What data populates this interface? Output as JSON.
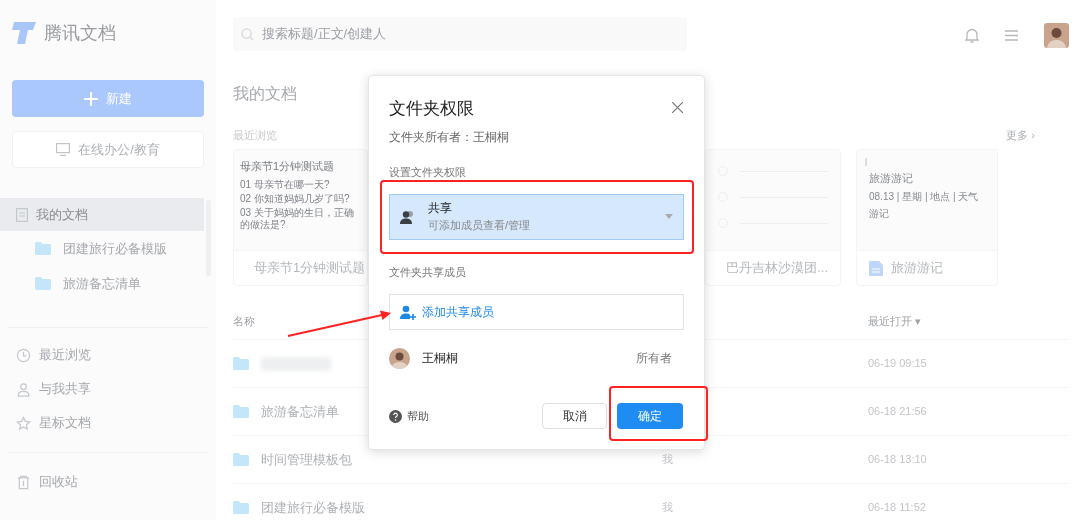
{
  "app": {
    "logo": "腾讯文档"
  },
  "sidebar": {
    "new_button": "新建",
    "office_button": "在线办公/教育",
    "tree": [
      {
        "label": "我的文档",
        "selected": true,
        "children": [
          {
            "label": "团建旅行必备模版",
            "selected": false
          },
          {
            "label": "旅游备忘清单",
            "selected": false
          }
        ]
      }
    ],
    "nav": [
      {
        "label": "最近浏览",
        "kind": "clock",
        "selected": false
      },
      {
        "label": "与我共享",
        "kind": "user",
        "selected": false
      },
      {
        "label": "星标文档",
        "kind": "star",
        "selected": false
      }
    ],
    "trash": {
      "label": "回收站",
      "kind": "trash"
    }
  },
  "header": {
    "search": {
      "placeholder": "搜索标题/正文/创建人"
    }
  },
  "main": {
    "title": "我的文档",
    "recent_label": "最近浏览",
    "more": "更多",
    "more_chevron": "›",
    "recent": [
      {
        "kind": "quiz",
        "preview_title": "母亲节1分钟测试题",
        "preview_lines": [
          "01  母亲节在哪一天?",
          "02  你知道妈妈几岁了吗?",
          "03  关于妈妈的生日，正确的做法是?"
        ],
        "name": "母亲节1分钟测试题"
      },
      {
        "kind": "checklist",
        "name": "巴丹吉林沙漠团..."
      },
      {
        "kind": "note",
        "preview_title": "旅游游记",
        "preview_lines": [
          "08.13 | 星期 | 地点 | 天气",
          "游记"
        ],
        "name": "旅游游记"
      }
    ],
    "columns": {
      "name": "名称",
      "opened": "最近打开",
      "sort_caret": "▾"
    },
    "rows": [
      {
        "name": "",
        "owner": "",
        "opened": "06-19 09:15"
      },
      {
        "name": "旅游备忘清单",
        "owner": "",
        "opened": "06-18 21:56"
      },
      {
        "name": "时间管理模板包",
        "owner": "我",
        "opened": "06-18 13:10"
      },
      {
        "name": "团建旅行必备模版",
        "owner": "我",
        "opened": "06-18 11:52"
      }
    ]
  },
  "dialog": {
    "title": "文件夹权限",
    "subtitle": "文件夹所有者：王桐桐",
    "permission_label": "设置文件夹权限",
    "permission": {
      "title": "共享",
      "description": "可添加成员查看/管理",
      "selected": true
    },
    "members_label": "文件夹共享成员",
    "add_member": "添加共享成员",
    "members": [
      {
        "name": "王桐桐",
        "role": "所有者"
      }
    ],
    "help": "帮助",
    "cancel": "取消",
    "confirm": "确定"
  }
}
